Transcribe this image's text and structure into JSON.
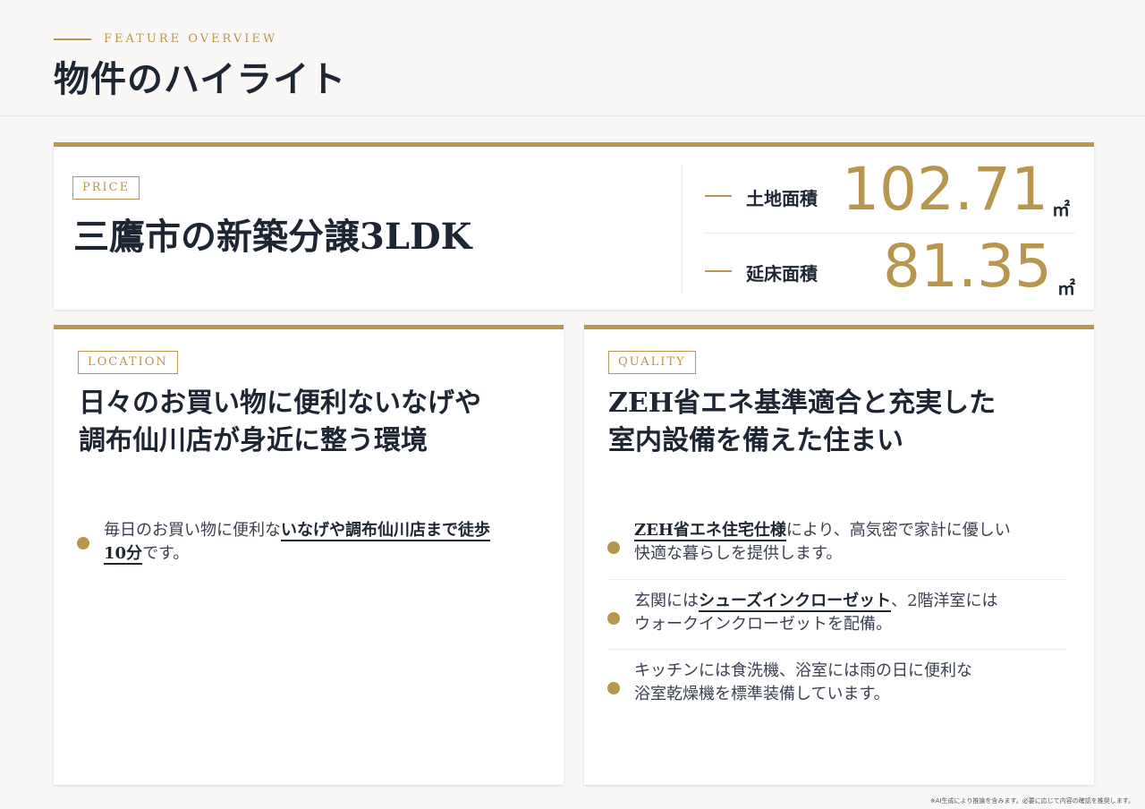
{
  "header": {
    "eyebrow": "FEATURE OVERVIEW",
    "title": "物件のハイライト"
  },
  "price_card": {
    "tag": "PRICE",
    "title": "三鷹市の新築分譲3LDK",
    "metrics": [
      {
        "label": "土地面積",
        "value": "102.71",
        "unit": "㎡"
      },
      {
        "label": "延床面積",
        "value": "81.35",
        "unit": "㎡"
      }
    ]
  },
  "location_card": {
    "tag": "LOCATION",
    "heading_line1": "日々のお買い物に便利ないなげや",
    "heading_line2": "調布仙川店が身近に整う環境",
    "features": [
      {
        "line1_pre": "毎日のお買い物に便利な",
        "line1_emph": "いなげや調布仙川店まで徒歩",
        "line2_emph": "10分",
        "line2_post": "です。"
      }
    ]
  },
  "quality_card": {
    "tag": "QUALITY",
    "heading_line1": "ZEH省エネ基準適合と充実した",
    "heading_line2": "室内設備を備えた住まい",
    "features": [
      {
        "line1_emph": "ZEH省エネ住宅仕様",
        "line1_post": "により、高気密で家計に優しい",
        "line2": "快適な暮らしを提供します。"
      },
      {
        "line1_pre": "玄関には",
        "line1_emph": "シューズインクローゼット",
        "line1_post": "、2階洋室には",
        "line2": "ウォークインクローゼットを配備。"
      },
      {
        "line1": "キッチンには食洗機、浴室には雨の日に便利な",
        "line2": "浴室乾燥機を標準装備しています。"
      }
    ]
  },
  "footnote": "※AI生成により推論を含みます。必要に応じて内容の確認を推奨します。",
  "colors": {
    "accent": "#b8964f",
    "text": "#1e2533",
    "background": "#f9f8f6"
  }
}
